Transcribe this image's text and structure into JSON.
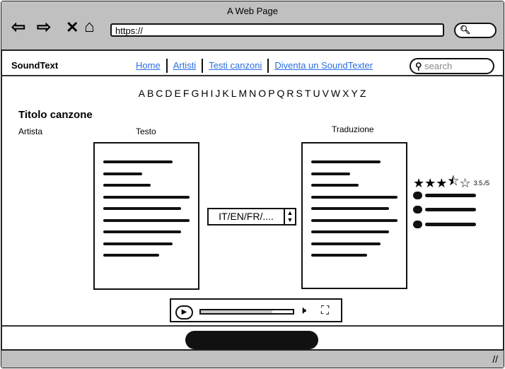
{
  "browser": {
    "title": "A Web Page",
    "url": "https://",
    "icons": [
      "back-arrow-icon",
      "forward-arrow-icon",
      "close-icon",
      "home-icon",
      "search-icon"
    ]
  },
  "header": {
    "logo": "SoundText",
    "nav": [
      "Home",
      "Artisti",
      "Testi canzoni",
      "Diventa un SoundTexter"
    ],
    "search_placeholder": "search"
  },
  "alphabet": [
    "A",
    "B",
    "C",
    "D",
    "E",
    "F",
    "G",
    "H",
    "I",
    "J",
    "K",
    "L",
    "M",
    "N",
    "O",
    "P",
    "Q",
    "R",
    "S",
    "T",
    "U",
    "V",
    "W",
    "X",
    "Y",
    "Z"
  ],
  "song": {
    "title": "Titolo canzone",
    "artist_label": "Artista",
    "lyrics_label": "Testo",
    "translation_label": "Traduzione",
    "language_select": "IT/EN/FR/...."
  },
  "rating": {
    "value": 3.5,
    "max": 5,
    "label": "3.5./5"
  },
  "player": {
    "progress": 0.78
  },
  "accent_link_color": "#2a6de0"
}
